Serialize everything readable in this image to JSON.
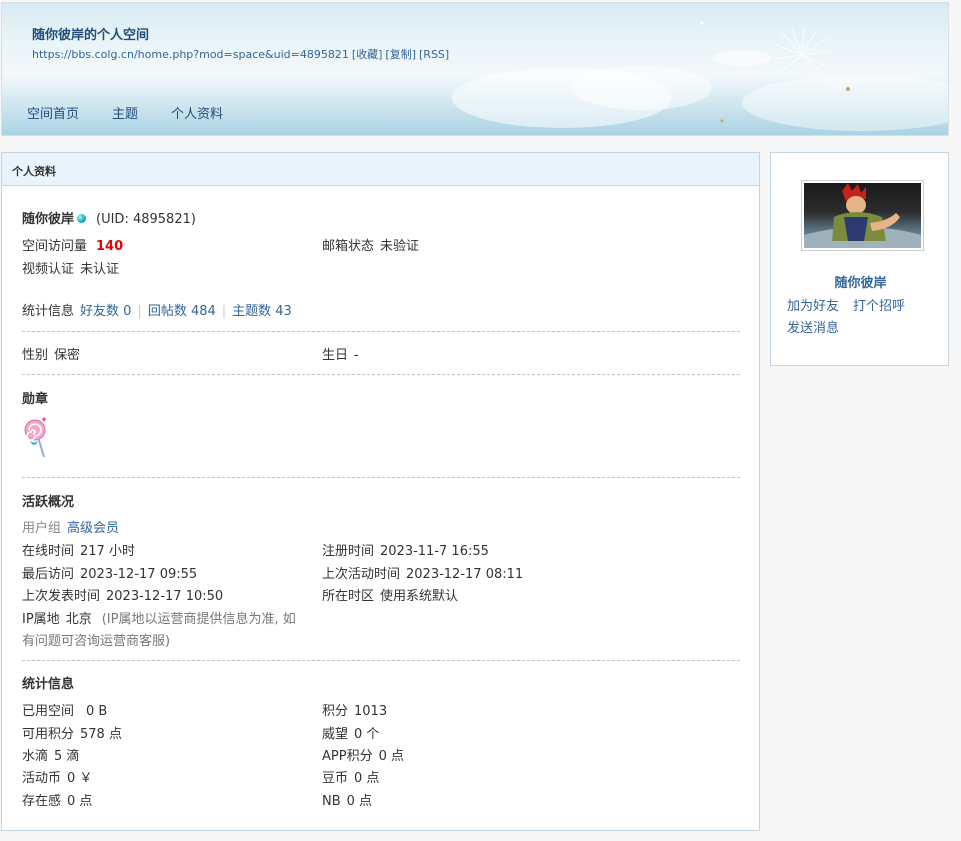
{
  "header": {
    "title": "随你彼岸的个人空间",
    "url": "https://bbs.colg.cn/home.php?mod=space&uid=4895821",
    "favorite": "[收藏]",
    "copy": "[复制]",
    "rss": "[RSS]"
  },
  "nav": [
    "空间首页",
    "主题",
    "个人资料"
  ],
  "panel": {
    "title": "个人资料"
  },
  "profile": {
    "username": "随你彼岸",
    "uid": "(UID: 4895821)",
    "visits_label": "空间访问量",
    "visits_value": "140",
    "email_label": "邮箱状态",
    "email_value": "未验证",
    "video_label": "视频认证",
    "video_value": "未认证",
    "stats_label": "统计信息",
    "friends": "好友数 0",
    "replies": "回帖数 484",
    "threads": "主题数 43",
    "gender_label": "性别",
    "gender_value": "保密",
    "birthday_label": "生日",
    "birthday_value": "-"
  },
  "medals": {
    "title": "勋章",
    "icon": "lollipop-medal-icon"
  },
  "activity": {
    "title": "活跃概况",
    "group_label": "用户组",
    "group_value": "高级会员",
    "online_label": "在线时间",
    "online_value": "217 小时",
    "register_label": "注册时间",
    "register_value": "2023-11-7 16:55",
    "last_visit_label": "最后访问",
    "last_visit_value": "2023-12-17 09:55",
    "last_active_label": "上次活动时间",
    "last_active_value": "2023-12-17 08:11",
    "last_post_label": "上次发表时间",
    "last_post_value": "2023-12-17 10:50",
    "timezone_label": "所在时区",
    "timezone_value": "使用系统默认",
    "ip_label": "IP属地",
    "ip_value": "北京",
    "ip_note_1": "(IP属地以运营商提供信息为准, 如",
    "ip_note_2": "有问题可咨询运营商客服)"
  },
  "statistics": {
    "title": "统计信息",
    "space_label": "已用空间",
    "space_value": "0 B",
    "points_label": "积分",
    "points_value": "1013",
    "avail_label": "可用积分",
    "avail_value": "578 点",
    "prestige_label": "威望",
    "prestige_value": "0 个",
    "water_label": "水滴",
    "water_value": "5 滴",
    "app_label": "APP积分",
    "app_value": "0 点",
    "coin_label": "活动币",
    "coin_value": "0 ￥",
    "bean_label": "豆币",
    "bean_value": "0 点",
    "presence_label": "存在感",
    "presence_value": "0 点",
    "nb_label": "NB",
    "nb_value": "0 点"
  },
  "side": {
    "name": "随你彼岸",
    "add_friend": "加为好友",
    "greet": "打个招呼",
    "message": "发送消息"
  }
}
